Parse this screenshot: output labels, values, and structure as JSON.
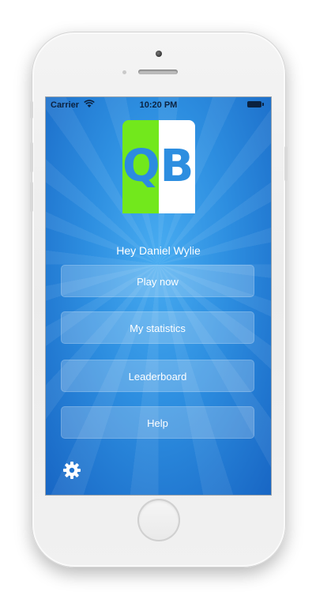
{
  "status_bar": {
    "carrier": "Carrier",
    "time": "10:20 PM"
  },
  "logo": {
    "letter_1": "Q",
    "letter_2": "B",
    "colors": {
      "q_background": "#72e81c",
      "b_background": "#ffffff"
    }
  },
  "greeting": "Hey Daniel Wylie",
  "menu": {
    "buttons": [
      {
        "label": "Play now"
      },
      {
        "label": "My statistics"
      },
      {
        "label": "Leaderboard"
      },
      {
        "label": "Help"
      }
    ]
  },
  "settings": {
    "icon": "gear-icon"
  },
  "theme": {
    "background_top": "#48acf1",
    "background_bottom": "#1866c4"
  }
}
